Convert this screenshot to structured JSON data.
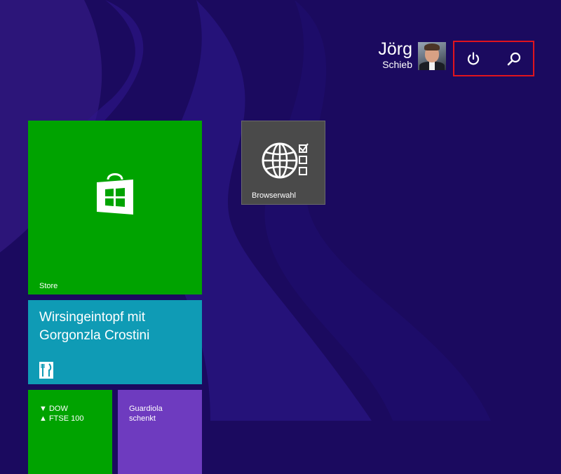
{
  "user": {
    "first_name": "Jörg",
    "last_name": "Schieb",
    "avatar_icon": "user-photo"
  },
  "actions": {
    "power_icon": "power-icon",
    "search_icon": "search-icon",
    "highlight_color": "#e0141e"
  },
  "tiles": {
    "store": {
      "label": "Store",
      "icon": "store-bag-icon",
      "color": "#00a300"
    },
    "browser": {
      "label": "Browserwahl",
      "icon": "globe-checklist-icon",
      "color": "#4a4a4a"
    },
    "recipe": {
      "title": "Wirsingeintopf mit Gorgonzla Crostini",
      "icon": "fork-knife-icon",
      "color": "#0f9bb5"
    },
    "finance": {
      "line1": "▼ DOW",
      "line2": "▲ FTSE 100",
      "color": "#00a300"
    },
    "sport": {
      "line1": "Guardiola",
      "line2": "schenkt",
      "color": "#6e3bbf"
    }
  },
  "background_color": "#1b0a5f"
}
